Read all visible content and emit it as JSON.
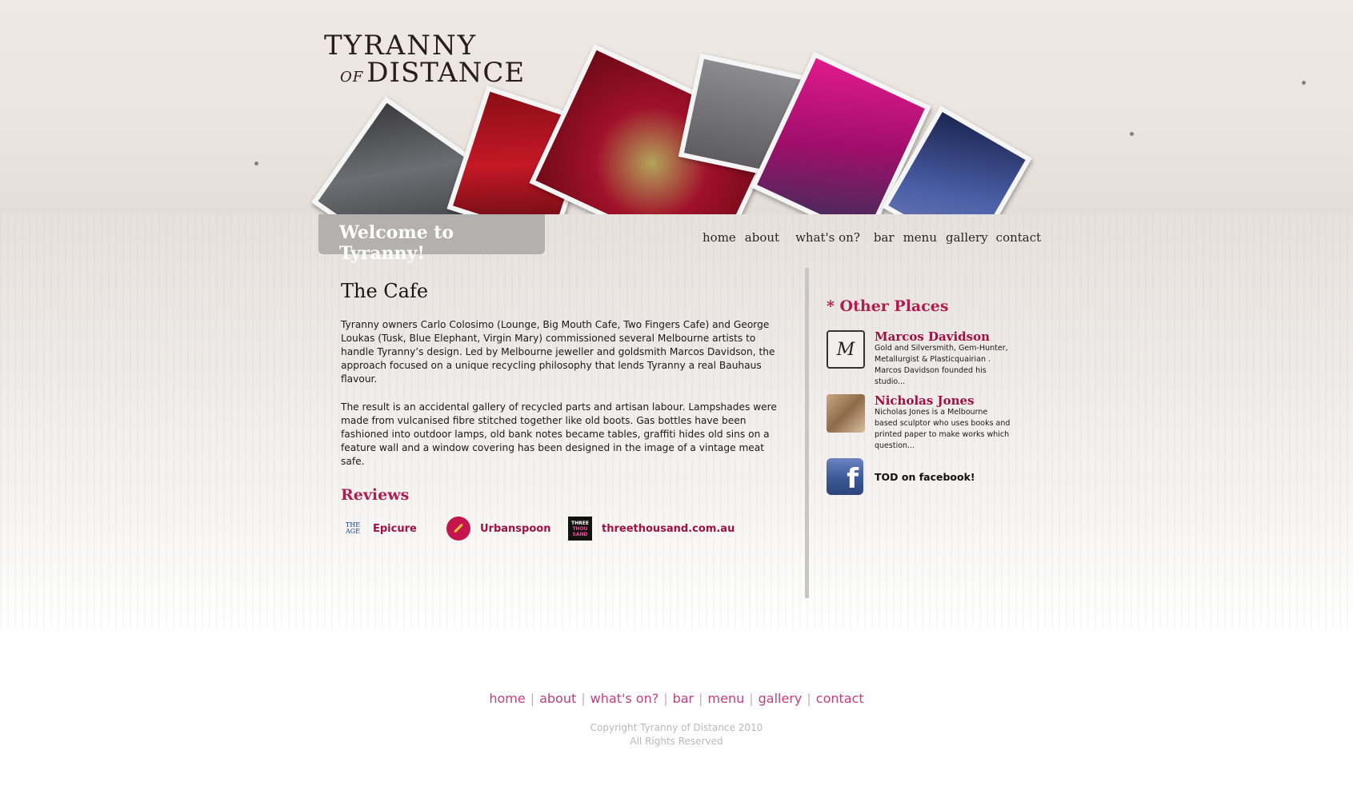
{
  "header": {
    "logo_line1": "TYRANNY",
    "logo_of": "OF",
    "logo_line2": "DISTANCE"
  },
  "welcome": "Welcome to Tyranny!",
  "nav": [
    "home",
    "about",
    "what's on?",
    "bar",
    "menu",
    "gallery",
    "contact"
  ],
  "main": {
    "title": "The Cafe",
    "paragraphs": [
      "Tyranny owners Carlo Colosimo (Lounge, Big Mouth Cafe, Two Fingers Cafe) and George Loukas (Tusk, Blue Elephant, Virgin Mary) commissioned several Melbourne artists to handle Tyranny’s design. Led by Melbourne jeweller and goldsmith Marcos Davidson, the approach focused on a unique recycling philosophy that lends Tyranny a real Bauhaus flavour.",
      "The result is an accidental gallery of recycled parts and artisan labour. Lampshades were made from vulcanised fibre stitched together like old boots. Gas bottles have been fashioned into outdoor lamps, old bank notes became tables, graffiti hides old sins on a feature wall and a window covering has been designed in the image of a vintage meat safe."
    ],
    "reviews_title": "Reviews",
    "reviews": [
      {
        "label": "Epicure",
        "icon": "the-age-icon",
        "icon_text": [
          "THE",
          "AGE"
        ]
      },
      {
        "label": "Urbanspoon",
        "icon": "urbanspoon-icon"
      },
      {
        "label": "threethousand.com.au",
        "icon": "threethousand-icon",
        "icon_text": [
          "THREE",
          "THOU",
          "SAND"
        ]
      }
    ]
  },
  "sidebar": {
    "title": "* Other Places",
    "places": [
      {
        "name": "Marcos Davidson",
        "desc": "Gold and Silversmith, Gem-Hunter, Metallurgist & Plasticquairian . Marcos Davidson founded his studio...",
        "thumb_text": "M"
      },
      {
        "name": "Nicholas Jones",
        "desc": "Nicholas Jones is a Melbourne based sculptor who uses books and printed paper to make works which question..."
      }
    ],
    "facebook_label": "TOD on facebook!",
    "facebook_glyph": "f"
  },
  "footer": {
    "nav": [
      "home",
      "about",
      "what's on?",
      "bar",
      "menu",
      "gallery",
      "contact"
    ],
    "copyright": "Copyright Tyranny of Distance 2010",
    "rights": "All Rights Reserved"
  },
  "colors": {
    "accent": "#b01e4e",
    "footer_link": "#c23f7a",
    "welcome_tab": "#b3b1b0"
  }
}
